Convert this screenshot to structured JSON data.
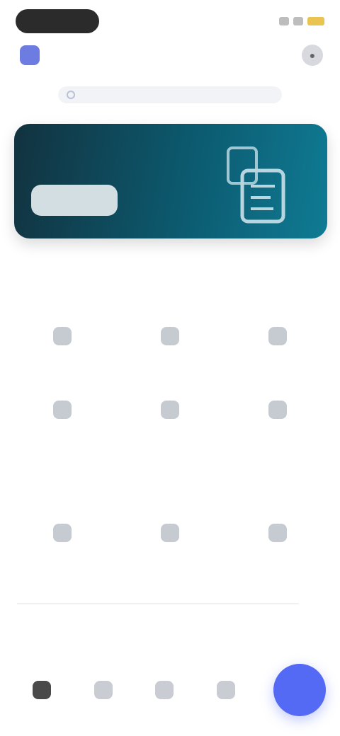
{
  "status_bar": {
    "time": "",
    "icons": [
      "signal-icon",
      "wifi-icon",
      "battery-icon"
    ]
  },
  "header": {
    "app_name": "",
    "logo_icon": "app-logo-icon",
    "action_icon": "profile-icon"
  },
  "search": {
    "placeholder": "",
    "icon": "search-icon"
  },
  "banner": {
    "title": "",
    "button_label": "",
    "illustration_icon": "banner-illustration-icon"
  },
  "sections": [
    {
      "title": "",
      "items": [
        {
          "label": "",
          "icon": "tile-icon"
        },
        {
          "label": "",
          "icon": "tile-icon"
        },
        {
          "label": "",
          "icon": "tile-icon"
        },
        {
          "label": "",
          "icon": "tile-icon"
        },
        {
          "label": "",
          "icon": "tile-icon"
        },
        {
          "label": "",
          "icon": "tile-icon"
        }
      ]
    },
    {
      "title": "",
      "items": [
        {
          "label": "",
          "icon": "tile-icon"
        },
        {
          "label": "",
          "icon": "tile-icon"
        },
        {
          "label": "",
          "icon": "tile-icon"
        }
      ]
    }
  ],
  "footer_note": "",
  "tabbar": {
    "tabs": [
      "home-icon",
      "compass-icon",
      "grid-icon",
      "user-icon"
    ],
    "active_index": 0,
    "fab_icon": "add-icon"
  },
  "colors": {
    "banner_dark": "#12323f",
    "banner_light": "#0f7b94",
    "accent": "#5469f4",
    "logo": "#6c7ce0"
  }
}
